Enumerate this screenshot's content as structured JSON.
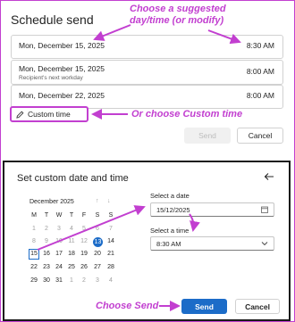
{
  "schedule": {
    "title": "Schedule send",
    "options": [
      {
        "date": "Mon, December 15, 2025",
        "time": "8:30 AM",
        "sub": ""
      },
      {
        "date": "Mon, December 15, 2025",
        "time": "8:00 AM",
        "sub": "Recipient's next workday"
      },
      {
        "date": "Mon, December 22, 2025",
        "time": "8:00 AM",
        "sub": ""
      }
    ],
    "custom_label": "Custom time",
    "send_label": "Send",
    "cancel_label": "Cancel"
  },
  "annotations": {
    "suggested_line1": "Choose a suggested",
    "suggested_line2": "day/time (or modify)",
    "custom": "Or choose Custom time",
    "send": "Choose Send",
    "color": "#c23fd0"
  },
  "custom_dialog": {
    "title": "Set custom date and time",
    "month": "December 2025",
    "weekdays": [
      "M",
      "T",
      "W",
      "T",
      "F",
      "S",
      "S"
    ],
    "weeks": [
      [
        "1",
        "2",
        "3",
        "4",
        "5",
        "6",
        "7"
      ],
      [
        "8",
        "9",
        "10",
        "11",
        "12",
        "13",
        "14"
      ],
      [
        "15",
        "16",
        "17",
        "18",
        "19",
        "20",
        "21"
      ],
      [
        "22",
        "23",
        "24",
        "25",
        "26",
        "27",
        "28"
      ],
      [
        "29",
        "30",
        "31",
        "1",
        "2",
        "3",
        "4"
      ]
    ],
    "today": "13",
    "selected_day": "15",
    "date_label": "Select a date",
    "date_value": "15/12/2025",
    "time_label": "Select a time",
    "time_value": "8:30 AM",
    "send_label": "Send",
    "cancel_label": "Cancel",
    "accent": "#1c6cc8"
  }
}
